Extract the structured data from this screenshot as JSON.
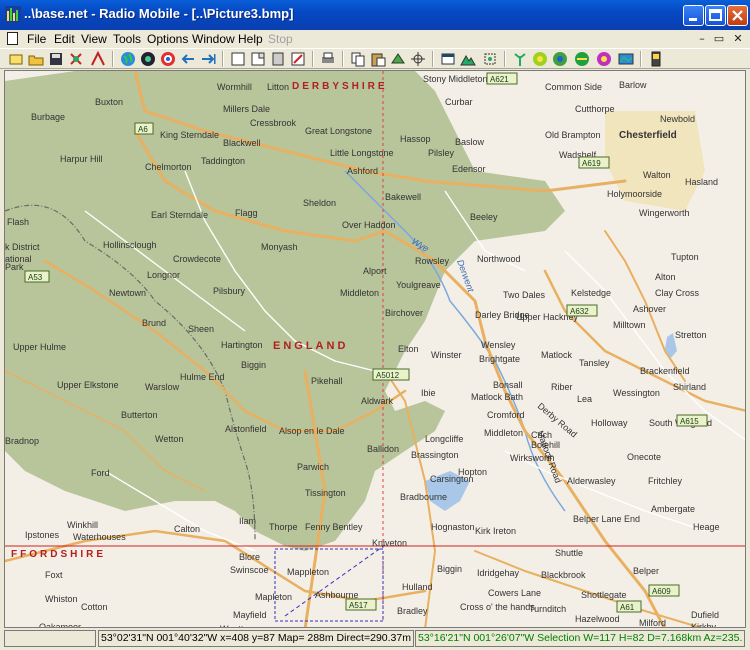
{
  "window": {
    "title": "..\\base.net - Radio Mobile - [..\\Picture3.bmp]"
  },
  "menu": {
    "items": [
      "File",
      "Edit",
      "View",
      "Tools",
      "Options",
      "Window",
      "Help"
    ],
    "disabled_item": "Stop"
  },
  "colors": {
    "titlebar": "#0548c4",
    "map_land": "#f4efe6",
    "map_park": "#b8c49a",
    "map_water": "#a9c7e8",
    "road_major": "#e8b060",
    "status_green": "#008000"
  },
  "map": {
    "regions": [
      "DERBYSHIRE",
      "ENGLAND",
      "FFORDSHIRE"
    ],
    "places": [
      {
        "name": "Wormhill"
      },
      {
        "name": "Litton"
      },
      {
        "name": "Curbar"
      },
      {
        "name": "Stony Middleton"
      },
      {
        "name": "Common Side"
      },
      {
        "name": "Barlow"
      },
      {
        "name": "Burbage"
      },
      {
        "name": "Buxton"
      },
      {
        "name": "Millers Dale"
      },
      {
        "name": "Cressbrook"
      },
      {
        "name": "Cutthorpe"
      },
      {
        "name": "Newbold"
      },
      {
        "name": "King Sterndale"
      },
      {
        "name": "Blackwell"
      },
      {
        "name": "Great Longstone"
      },
      {
        "name": "Hassop"
      },
      {
        "name": "Baslow"
      },
      {
        "name": "Old Brampton"
      },
      {
        "name": "Chesterfield"
      },
      {
        "name": "Harpur Hill"
      },
      {
        "name": "Chelmorton"
      },
      {
        "name": "Taddington"
      },
      {
        "name": "Little Longstone"
      },
      {
        "name": "Pilsley"
      },
      {
        "name": "Wadshelf"
      },
      {
        "name": "Ashford"
      },
      {
        "name": "Edensor"
      },
      {
        "name": "Walton"
      },
      {
        "name": "Hasland"
      },
      {
        "name": "Holymoorside"
      },
      {
        "name": "Bakewell"
      },
      {
        "name": "Sheldon"
      },
      {
        "name": "Flash"
      },
      {
        "name": "Earl Sterndale"
      },
      {
        "name": "Flagg"
      },
      {
        "name": "Beeley"
      },
      {
        "name": "Wingerworth"
      },
      {
        "name": "Over Haddon"
      },
      {
        "name": "k District"
      },
      {
        "name": "ational"
      },
      {
        "name": "Park"
      },
      {
        "name": "Hollinsclough"
      },
      {
        "name": "Crowdecote"
      },
      {
        "name": "Monyash"
      },
      {
        "name": "Rowsley"
      },
      {
        "name": "Northwood"
      },
      {
        "name": "Tupton"
      },
      {
        "name": "Alport"
      },
      {
        "name": "Youlgreave"
      },
      {
        "name": "Longnor"
      },
      {
        "name": "Alton"
      },
      {
        "name": "Newtown"
      },
      {
        "name": "Pilsbury"
      },
      {
        "name": "Middleton"
      },
      {
        "name": "Two Dales"
      },
      {
        "name": "Kelstedge"
      },
      {
        "name": "Clay Cross"
      },
      {
        "name": "Brund"
      },
      {
        "name": "Sheen"
      },
      {
        "name": "Birchover"
      },
      {
        "name": "Darley Bridge"
      },
      {
        "name": "Upper Hackney"
      },
      {
        "name": "Ashover"
      },
      {
        "name": "Milltown"
      },
      {
        "name": "Hartington"
      },
      {
        "name": "Stretton"
      },
      {
        "name": "Upper Hulme"
      },
      {
        "name": "Biggin"
      },
      {
        "name": "Elton"
      },
      {
        "name": "Winster"
      },
      {
        "name": "Wensley"
      },
      {
        "name": "Matlock"
      },
      {
        "name": "Tansley"
      },
      {
        "name": "Brightgate"
      },
      {
        "name": "Brackenfield"
      },
      {
        "name": "Hulme End"
      },
      {
        "name": "Pikehall"
      },
      {
        "name": "Upper Elkstone"
      },
      {
        "name": "Warslow"
      },
      {
        "name": "Riber"
      },
      {
        "name": "Shirland"
      },
      {
        "name": "Bonsall"
      },
      {
        "name": "Ibie"
      },
      {
        "name": "Matlock Bath"
      },
      {
        "name": "Lea"
      },
      {
        "name": "Wessington"
      },
      {
        "name": "Aldwark"
      },
      {
        "name": "Butterton"
      },
      {
        "name": "Cromford"
      },
      {
        "name": "Holloway"
      },
      {
        "name": "South Wingfield"
      },
      {
        "name": "Alstonfield"
      },
      {
        "name": "Alsop en le Dale"
      },
      {
        "name": "Longcliffe"
      },
      {
        "name": "Middleton"
      },
      {
        "name": "Bolehill"
      },
      {
        "name": "Bradnop"
      },
      {
        "name": "Wetton"
      },
      {
        "name": "Ballidon"
      },
      {
        "name": "Brassington"
      },
      {
        "name": "Crich"
      },
      {
        "name": "Onecote"
      },
      {
        "name": "Parwich"
      },
      {
        "name": "Hopton"
      },
      {
        "name": "Wirksworth"
      },
      {
        "name": "Ford"
      },
      {
        "name": "Carsington"
      },
      {
        "name": "Alderwasley"
      },
      {
        "name": "Fritchley"
      },
      {
        "name": "Tissington"
      },
      {
        "name": "Bradbourne"
      },
      {
        "name": "Ambergate"
      },
      {
        "name": "Ilam"
      },
      {
        "name": "Winkhill"
      },
      {
        "name": "Hognaston"
      },
      {
        "name": "Belper Lane End"
      },
      {
        "name": "Heage"
      },
      {
        "name": "Thorpe"
      },
      {
        "name": "Fenny Bentley"
      },
      {
        "name": "Calton"
      },
      {
        "name": "Kirk Ireton"
      },
      {
        "name": "Ipstones"
      },
      {
        "name": "Waterhouses"
      },
      {
        "name": "Kniveton"
      },
      {
        "name": "Shuttle"
      },
      {
        "name": "Blore"
      },
      {
        "name": "Swinscoe"
      },
      {
        "name": "Mappleton"
      },
      {
        "name": "Biggin"
      },
      {
        "name": "Idridgehay"
      },
      {
        "name": "Blackbrook"
      },
      {
        "name": "Belper"
      },
      {
        "name": "Foxt"
      },
      {
        "name": "Hulland"
      },
      {
        "name": "Cowers Lane"
      },
      {
        "name": "Shottlegate"
      },
      {
        "name": "Ashbourne"
      },
      {
        "name": "Mapleton"
      },
      {
        "name": "Whiston"
      },
      {
        "name": "Cotton"
      },
      {
        "name": "Mayfield"
      },
      {
        "name": "Bradley"
      },
      {
        "name": "Cross o' the hands"
      },
      {
        "name": "Turnditch"
      },
      {
        "name": "Hazelwood"
      },
      {
        "name": "Milford"
      },
      {
        "name": "Dufield"
      },
      {
        "name": "Oakamoor"
      },
      {
        "name": "Wootton"
      },
      {
        "name": "Kirkby"
      },
      {
        "name": "Matlock Road"
      }
    ],
    "roads": [
      "A621",
      "A6",
      "A619",
      "A53",
      "A632",
      "A5012",
      "A615",
      "A517",
      "A609",
      "A61",
      "Derby Road"
    ],
    "rivers": [
      "Wye",
      "Derwent"
    ]
  },
  "status": {
    "cursor": "53°02'31\"N  001°40'32\"W  x=408 y=87 Map= 288m Direct=290.37m SF",
    "selection": "53°16'21\"N  001°26'07\"W  Selection W=117 H=82 D=7.168km Az=235."
  }
}
